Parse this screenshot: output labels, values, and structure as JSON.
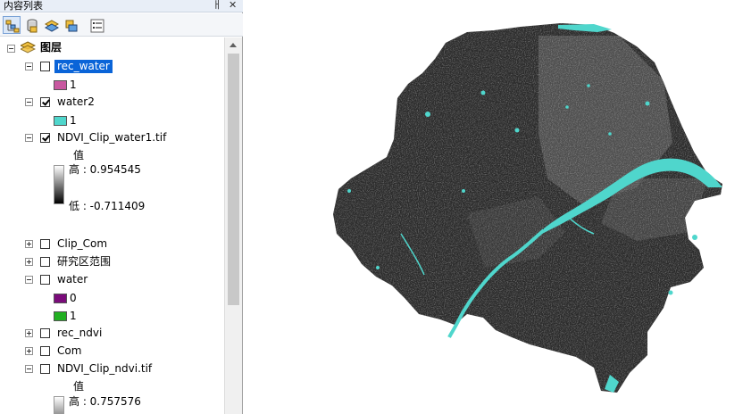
{
  "toc": {
    "title": "内容列表",
    "pin_glyph": "ㅐ",
    "close_glyph": "✕",
    "toolbar": {
      "buttons": [
        "list-by-drawing-order",
        "list-by-source",
        "list-by-visibility",
        "list-by-selection",
        "options"
      ]
    },
    "root_label": "图层",
    "layers": [
      {
        "name": "rec_water",
        "checked": false,
        "expanded": true,
        "selected": true,
        "classes": [
          {
            "label": "1",
            "color": "#c858a0"
          }
        ]
      },
      {
        "name": "water2",
        "checked": true,
        "expanded": true,
        "classes": [
          {
            "label": "1",
            "color": "#4fd6cc"
          }
        ]
      },
      {
        "name": "NDVI_Clip_water1.tif",
        "checked": true,
        "expanded": true,
        "raster": {
          "heading": "值",
          "high": "高 : 0.954545",
          "low": "低 : -0.711409"
        }
      },
      {
        "name": "Clip_Com",
        "checked": false,
        "expanded": false
      },
      {
        "name": "研究区范围",
        "checked": false,
        "expanded": false
      },
      {
        "name": "water",
        "checked": false,
        "expanded": true,
        "classes": [
          {
            "label": "0",
            "color": "#7a0b7a"
          },
          {
            "label": "1",
            "color": "#22b022"
          }
        ]
      },
      {
        "name": "rec_ndvi",
        "checked": false,
        "expanded": false
      },
      {
        "name": "Com",
        "checked": false,
        "expanded": false
      },
      {
        "name": "NDVI_Clip_ndvi.tif",
        "checked": false,
        "expanded": true,
        "raster": {
          "heading": "值",
          "high": "高 : 0.757576"
        }
      }
    ]
  },
  "map": {
    "region_fill": "#2a2a2a",
    "water_color": "#4fd6cc"
  }
}
